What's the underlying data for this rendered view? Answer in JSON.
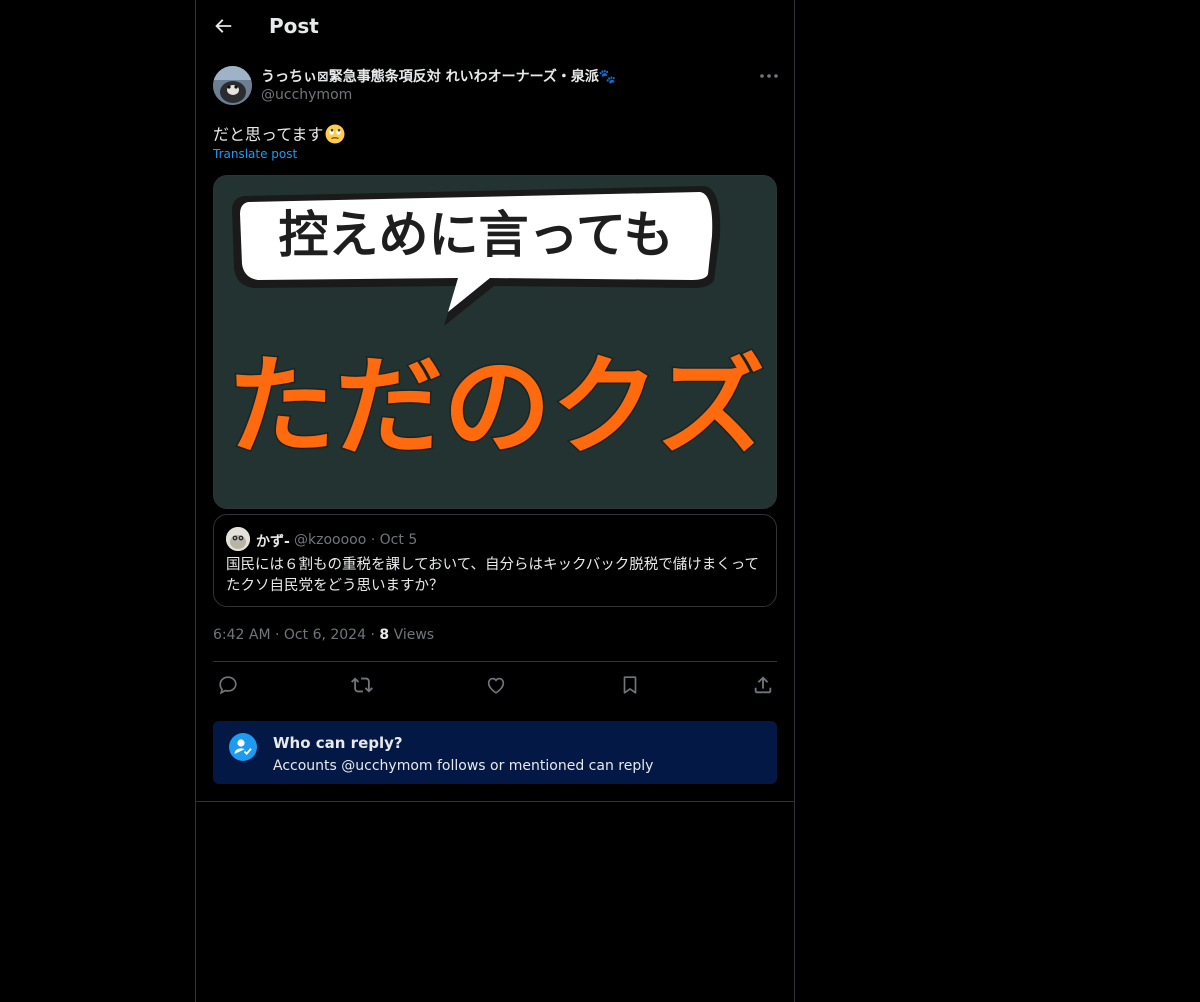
{
  "header": {
    "title": "Post",
    "back_icon": "back-arrow-icon"
  },
  "post": {
    "display_name": "うっちぃ⊠緊急事態条項反対 れいわオーナーズ・泉派🐾",
    "handle": "@ucchymom",
    "text": "だと思ってます",
    "emoji": "face-with-rolling-eyes",
    "translate_label": "Translate post",
    "media": {
      "bubble_text": "控えめに言っても",
      "main_text": "ただのクズ",
      "colors": {
        "background": "#233331",
        "main_text": "#ff6a0f",
        "bubble": "#ffffff"
      }
    },
    "quote": {
      "name": "かず-",
      "handle": "@kzooooo",
      "separator": "·",
      "date": "Oct 5",
      "text": "国民には６割もの重税を課しておいて、自分らはキックバック脱税で儲けまくってたクソ自民党をどう思いますか？"
    },
    "time": "6:42 AM",
    "sep1": "·",
    "date": "Oct 6, 2024",
    "sep2": "·",
    "views_count": "8",
    "views_label": "Views"
  },
  "actions": [
    {
      "name": "reply-icon"
    },
    {
      "name": "repost-icon"
    },
    {
      "name": "like-icon"
    },
    {
      "name": "bookmark-icon"
    },
    {
      "name": "share-icon"
    }
  ],
  "who_can_reply": {
    "title": "Who can reply?",
    "subtitle": "Accounts @ucchymom follows or mentioned can reply"
  },
  "colors": {
    "accent": "#1d9bf0",
    "text": "#e7e9ea",
    "muted": "#71767b",
    "border": "#2f3336",
    "notice_bg": "#031844"
  }
}
